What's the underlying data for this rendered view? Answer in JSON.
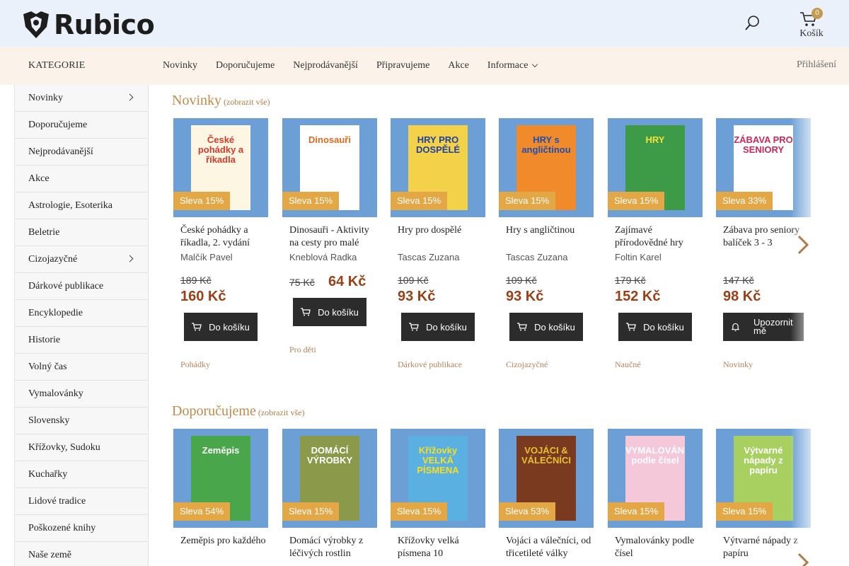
{
  "header": {
    "logo_text": "Rubico",
    "cart_count": "0",
    "cart_label": "Košík"
  },
  "nav": {
    "kategorie": "KATEGORIE",
    "items": [
      "Novinky",
      "Doporučujeme",
      "Nejprodávanější",
      "Připravujeme",
      "Akce",
      "Informace"
    ],
    "login": "Přihlášení"
  },
  "sidebar": {
    "items": [
      "Novinky",
      "Doporučujeme",
      "Nejprodávanější",
      "Akce",
      "Astrologie, Esoterika",
      "Beletrie",
      "Cizojazyčné",
      "Dárkové publikace",
      "Encyklopedie",
      "Historie",
      "Volný čas",
      "Vymalovánky",
      "Slovensky",
      "Křížovky, Sudoku",
      "Kuchařky",
      "Lidové tradice",
      "Poškozené knihy",
      "Naše země"
    ]
  },
  "sections": [
    {
      "title": "Novinky",
      "more": "(zobrazit vše)",
      "products": [
        {
          "name": "České pohádky a říkadla, 2. vydání",
          "author": "Malčík Pavel",
          "badge": "Sleva 15%",
          "old_price": "189 Kč",
          "price": "160 Kč",
          "button": "Do košíku",
          "category": "Pohádky",
          "cover_text": "České pohádky a říkadla",
          "cover_bg": "#fdf6e3",
          "cover_color": "#d23a2a"
        },
        {
          "name": "Dinosauři - Aktivity na cesty pro malé",
          "author": "Kneblová Radka",
          "badge": "Sleva 15%",
          "old_price": "75 Kč",
          "price": "64 Kč",
          "button": "Do košíku",
          "category": "Pro děti",
          "cover_text": "Dinosauři",
          "cover_bg": "#ffffff",
          "cover_color": "#e06a1f"
        },
        {
          "name": "Hry pro dospělé",
          "author": "Tascas Zuzana",
          "badge": "Sleva 15%",
          "old_price": "109 Kč",
          "price": "93 Kč",
          "button": "Do košíku",
          "category": "Dárkové publikace",
          "cover_text": "HRY PRO DOSPĚLÉ",
          "cover_bg": "#f3d24a",
          "cover_color": "#2040a0"
        },
        {
          "name": "Hry s angličtinou",
          "author": "Tascas Zuzana",
          "badge": "Sleva 15%",
          "old_price": "109 Kč",
          "price": "93 Kč",
          "button": "Do košíku",
          "category": "Cizojazyčné",
          "cover_text": "HRY s angličtinou",
          "cover_bg": "#f08a2a",
          "cover_color": "#1e4fb0"
        },
        {
          "name": "Zajímavé přírodovědné hry",
          "author": "Foltin Karel",
          "badge": "Sleva 15%",
          "old_price": "179 Kč",
          "price": "152 Kč",
          "button": "Do košíku",
          "category": "Naučné",
          "cover_text": "HRY",
          "cover_bg": "#3d9b48",
          "cover_color": "#f2e23a"
        },
        {
          "name": "Zábava pro seniory balíček 3 - 3",
          "author": "",
          "badge": "Sleva 33%",
          "old_price": "147 Kč",
          "price": "98 Kč",
          "button": "Upozornit mě",
          "category": "Novinky",
          "cover_text": "ZÁBAVA PRO SENIORY",
          "cover_bg": "#ffffff",
          "cover_color": "#c8285a"
        }
      ]
    },
    {
      "title": "Doporučujeme",
      "more": "(zobrazit vše)",
      "products": [
        {
          "name": "Zeměpis pro každého",
          "author": "",
          "badge": "Sleva 54%",
          "cover_text": "Zeměpis",
          "cover_bg": "#4aa64a",
          "cover_color": "#ffffff"
        },
        {
          "name": "Domácí výrobky z léčivých rostlin",
          "author": "",
          "badge": "Sleva 15%",
          "cover_text": "DOMÁCÍ VÝROBKY",
          "cover_bg": "#8a9a4a",
          "cover_color": "#ffffff"
        },
        {
          "name": "Křížovky velká písmena 10",
          "author": "",
          "badge": "Sleva 15%",
          "cover_text": "Křížovky VELKÁ PÍSMENA",
          "cover_bg": "#5ab0e0",
          "cover_color": "#f5e020"
        },
        {
          "name": "Vojáci a válečníci, od třicetileté války",
          "author": "",
          "badge": "Sleva 53%",
          "cover_text": "VOJÁCI & VÁLEČNÍCI",
          "cover_bg": "#7a3a20",
          "cover_color": "#e8c030"
        },
        {
          "name": "Vymalovánky podle čísel",
          "author": "",
          "badge": "Sleva 15%",
          "cover_text": "VYMALOVÁNKY podle čísel",
          "cover_bg": "#f4c8d8",
          "cover_color": "#ffffff"
        },
        {
          "name": "Výtvarné nápady z papíru",
          "author": "",
          "badge": "Sleva 15%",
          "cover_text": "Výtvarné nápady z papíru",
          "cover_bg": "#a8d060",
          "cover_color": "#ffffff"
        }
      ]
    }
  ]
}
